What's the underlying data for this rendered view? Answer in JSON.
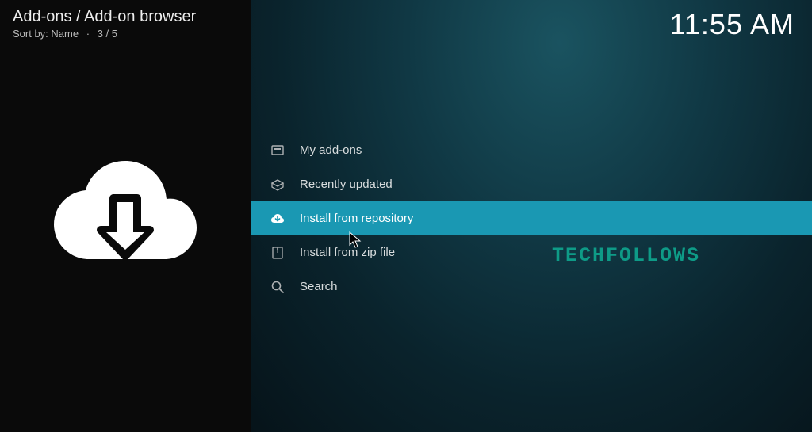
{
  "header": {
    "breadcrumb": "Add-ons / Add-on browser",
    "sort_prefix": "Sort by:",
    "sort_value": "Name",
    "position": "3 / 5"
  },
  "clock": "11:55 AM",
  "menu": {
    "items": [
      {
        "icon": "my-addons-icon",
        "label": "My add-ons",
        "selected": false
      },
      {
        "icon": "box-open-icon",
        "label": "Recently updated",
        "selected": false
      },
      {
        "icon": "cloud-download-icon",
        "label": "Install from repository",
        "selected": true
      },
      {
        "icon": "zip-file-icon",
        "label": "Install from zip file",
        "selected": false
      },
      {
        "icon": "search-icon",
        "label": "Search",
        "selected": false
      }
    ]
  },
  "watermark": "TECHFOLLOWS"
}
